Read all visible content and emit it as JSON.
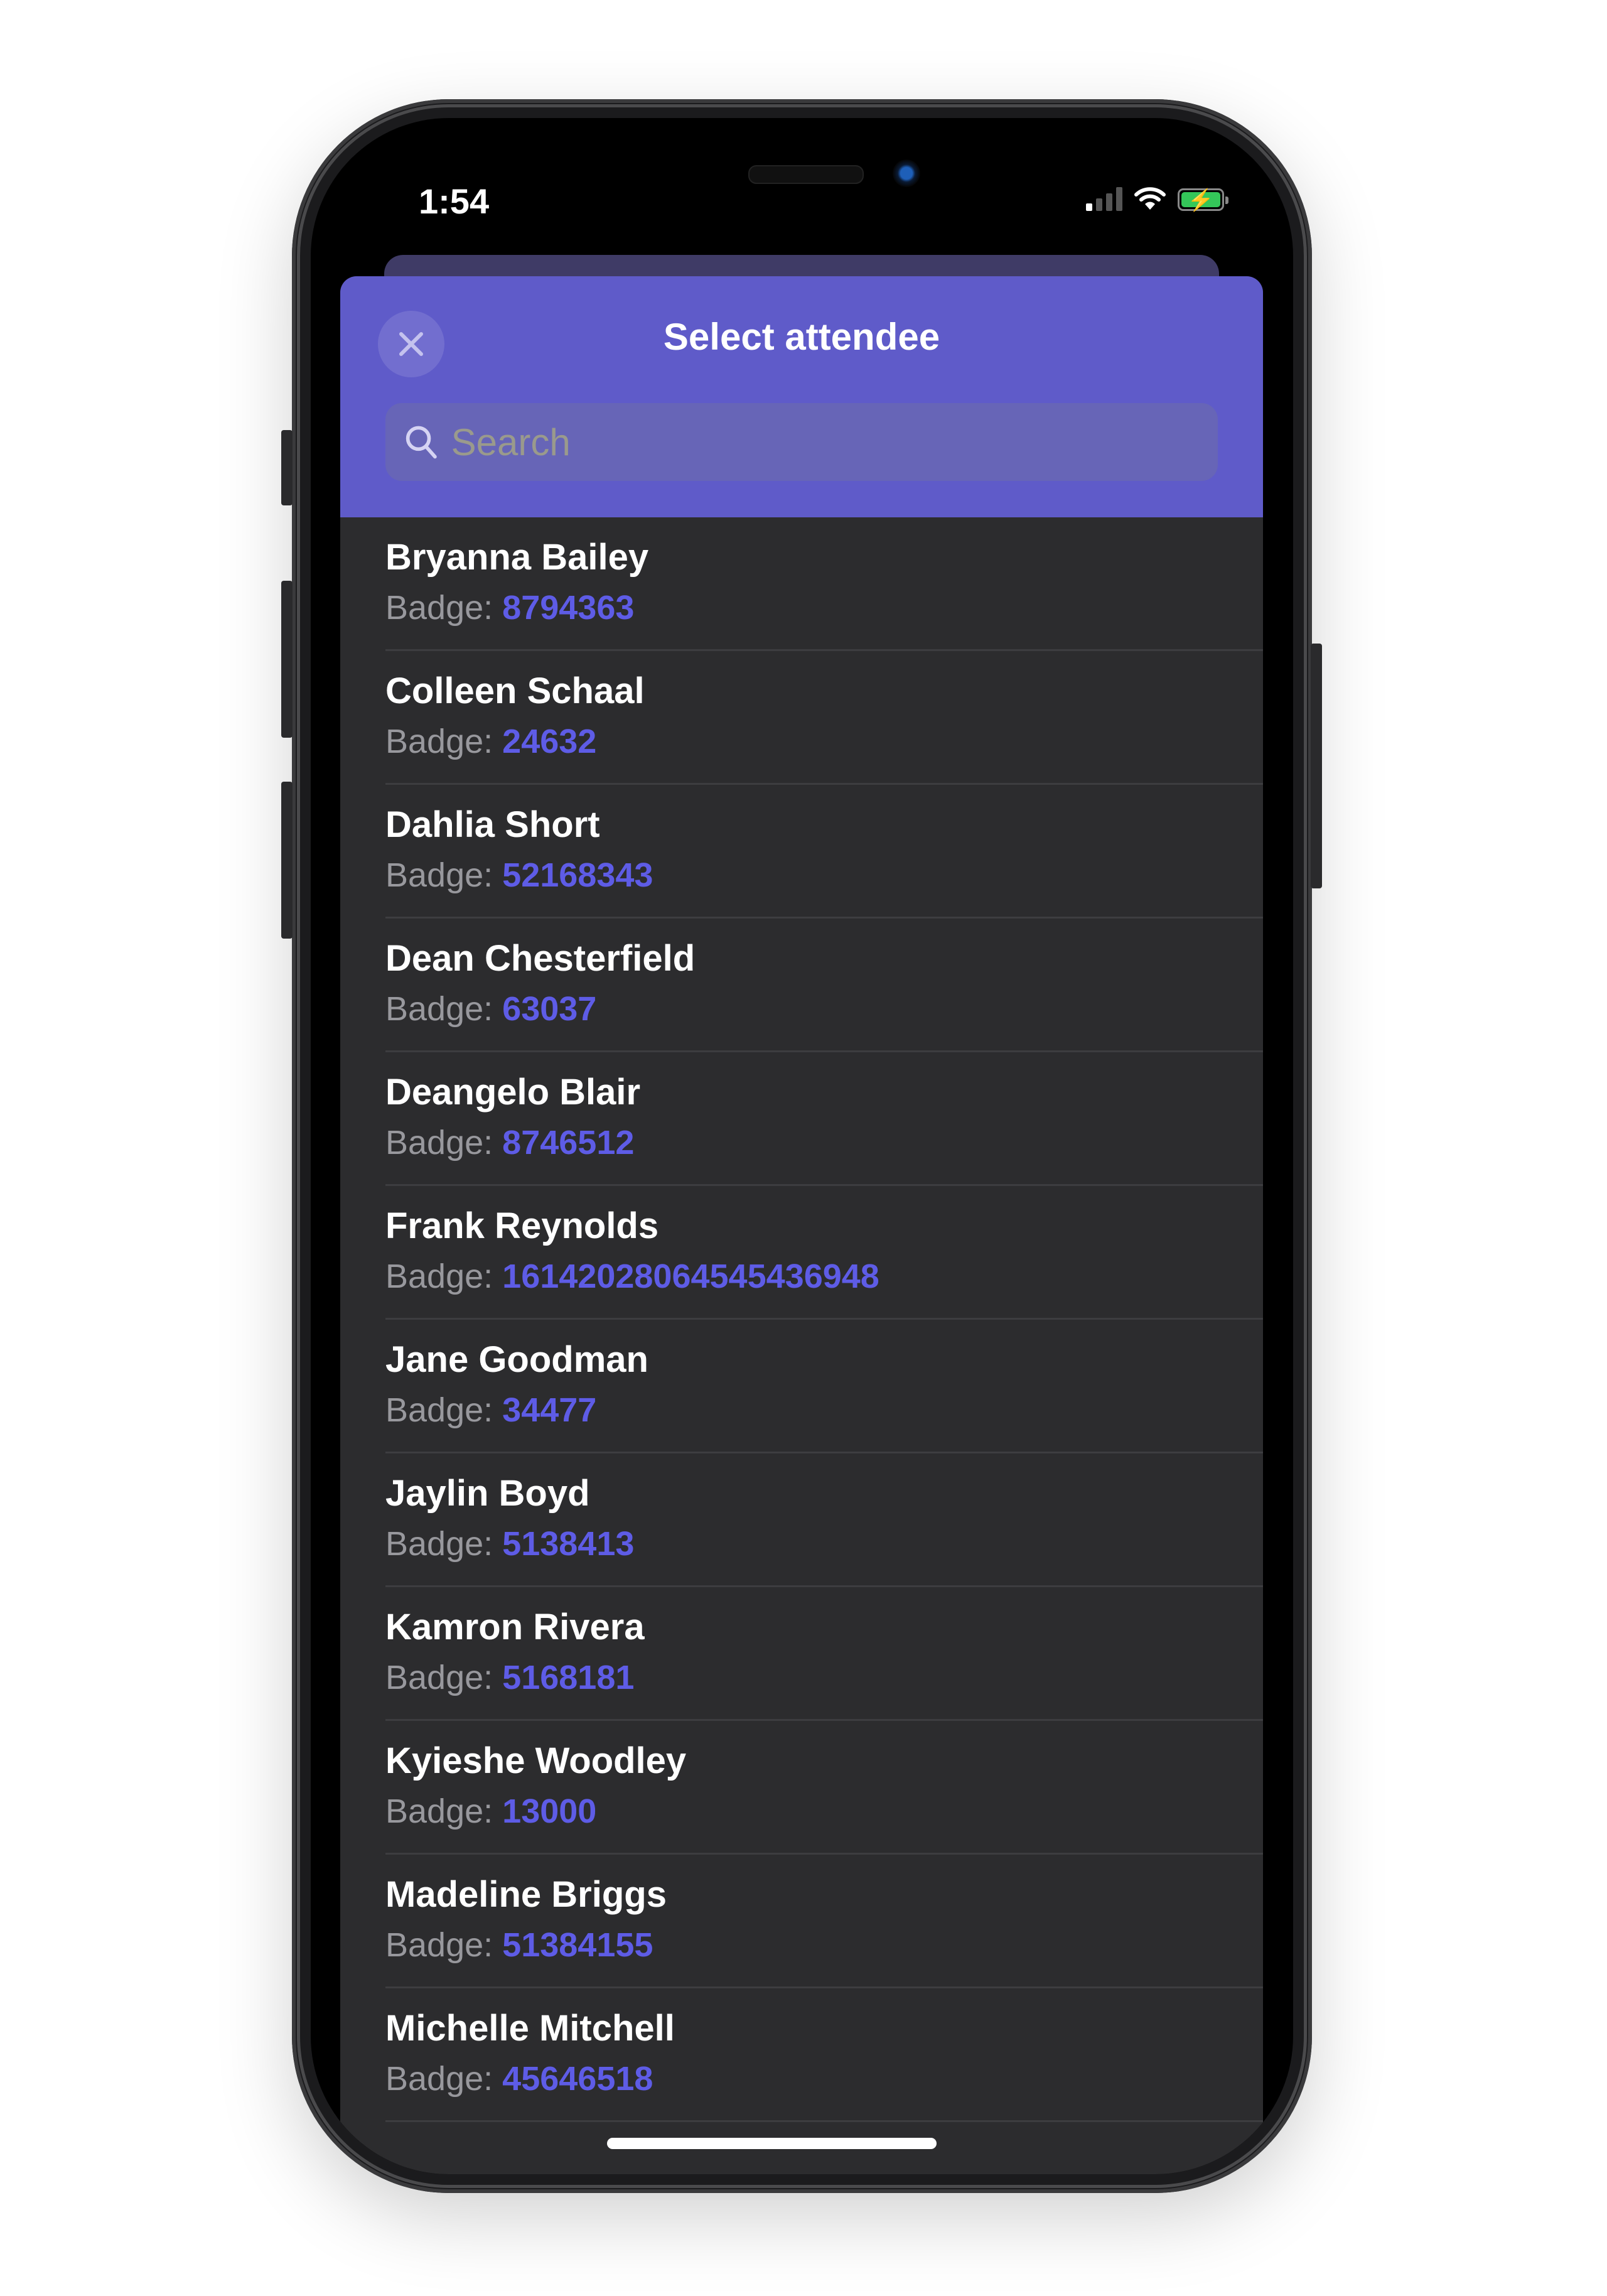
{
  "status_bar": {
    "time": "1:54",
    "signal_bars_on": 1,
    "signal_bars_total": 4,
    "wifi": "wifi-icon",
    "battery": "battery-charging-icon",
    "battery_color": "#34c759"
  },
  "header": {
    "title": "Select attendee",
    "close_icon": "close-icon",
    "background": "#5f5bc9"
  },
  "search": {
    "placeholder": "Search",
    "value": "",
    "icon": "search-icon"
  },
  "attendees": [
    {
      "name": "Bryanna Bailey",
      "badge_label": "Badge:",
      "badge": "8794363"
    },
    {
      "name": "Colleen Schaal",
      "badge_label": "Badge:",
      "badge": "24632"
    },
    {
      "name": "Dahlia Short",
      "badge_label": "Badge:",
      "badge": "52168343"
    },
    {
      "name": "Dean Chesterfield",
      "badge_label": "Badge:",
      "badge": "63037"
    },
    {
      "name": "Deangelo Blair",
      "badge_label": "Badge:",
      "badge": "8746512"
    },
    {
      "name": "Frank Reynolds",
      "badge_label": "Badge:",
      "badge": "16142028064545436948"
    },
    {
      "name": "Jane Goodman",
      "badge_label": "Badge:",
      "badge": "34477"
    },
    {
      "name": "Jaylin Boyd",
      "badge_label": "Badge:",
      "badge": "5138413"
    },
    {
      "name": "Kamron Rivera",
      "badge_label": "Badge:",
      "badge": "5168181"
    },
    {
      "name": "Kyieshe Woodley",
      "badge_label": "Badge:",
      "badge": "13000"
    },
    {
      "name": "Madeline Briggs",
      "badge_label": "Badge:",
      "badge": "51384155"
    },
    {
      "name": "Michelle Mitchell",
      "badge_label": "Badge:",
      "badge": "45646518"
    }
  ],
  "colors": {
    "accent": "#5e5ce6",
    "list_background": "#2c2c2e",
    "secondary_text": "#98989d"
  }
}
